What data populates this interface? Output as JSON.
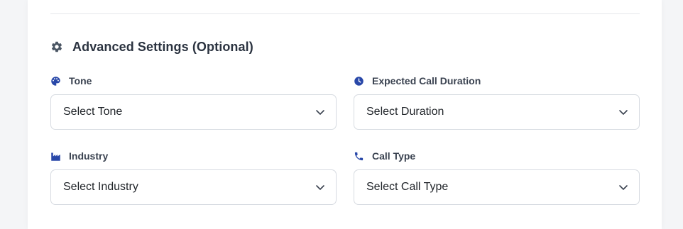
{
  "section": {
    "title": "Advanced Settings (Optional)",
    "icon": "gear-icon"
  },
  "colors": {
    "accent_icon": "#2847a8",
    "section_icon": "#4a5563"
  },
  "fields": [
    {
      "label": "Tone",
      "icon": "palette-icon",
      "selected": "Select Tone"
    },
    {
      "label": "Expected Call Duration",
      "icon": "clock-icon",
      "selected": "Select Duration"
    },
    {
      "label": "Industry",
      "icon": "industry-icon",
      "selected": "Select Industry"
    },
    {
      "label": "Call Type",
      "icon": "phone-icon",
      "selected": "Select Call Type"
    }
  ]
}
